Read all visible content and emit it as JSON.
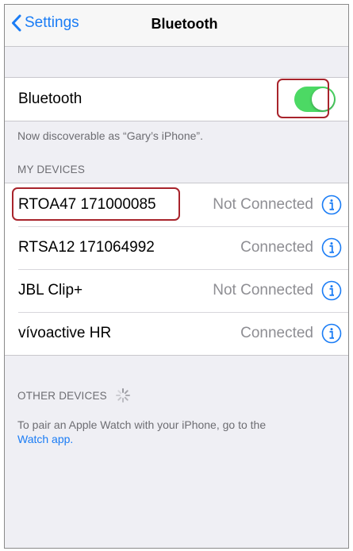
{
  "nav": {
    "back_label": "Settings",
    "title": "Bluetooth"
  },
  "bluetooth": {
    "label": "Bluetooth",
    "enabled": true,
    "discoverable_note": "Now discoverable as “Gary’s iPhone”."
  },
  "my_devices": {
    "header": "MY DEVICES",
    "items": [
      {
        "name": "RTOA47 171000085",
        "status": "Not Connected"
      },
      {
        "name": "RTSA12 171064992",
        "status": "Connected"
      },
      {
        "name": "JBL Clip+",
        "status": "Not Connected"
      },
      {
        "name": "vívoactive HR",
        "status": "Connected"
      }
    ]
  },
  "other_devices": {
    "header": "OTHER DEVICES",
    "pair_text": "To pair an Apple Watch with your iPhone, go to the",
    "pair_link": "Watch app."
  },
  "colors": {
    "accent": "#1a7cf5",
    "toggle_on": "#4cd964",
    "highlight": "#a8242c"
  },
  "icons": [
    "chevron-left-icon",
    "info-icon",
    "loading-spinner-icon"
  ]
}
